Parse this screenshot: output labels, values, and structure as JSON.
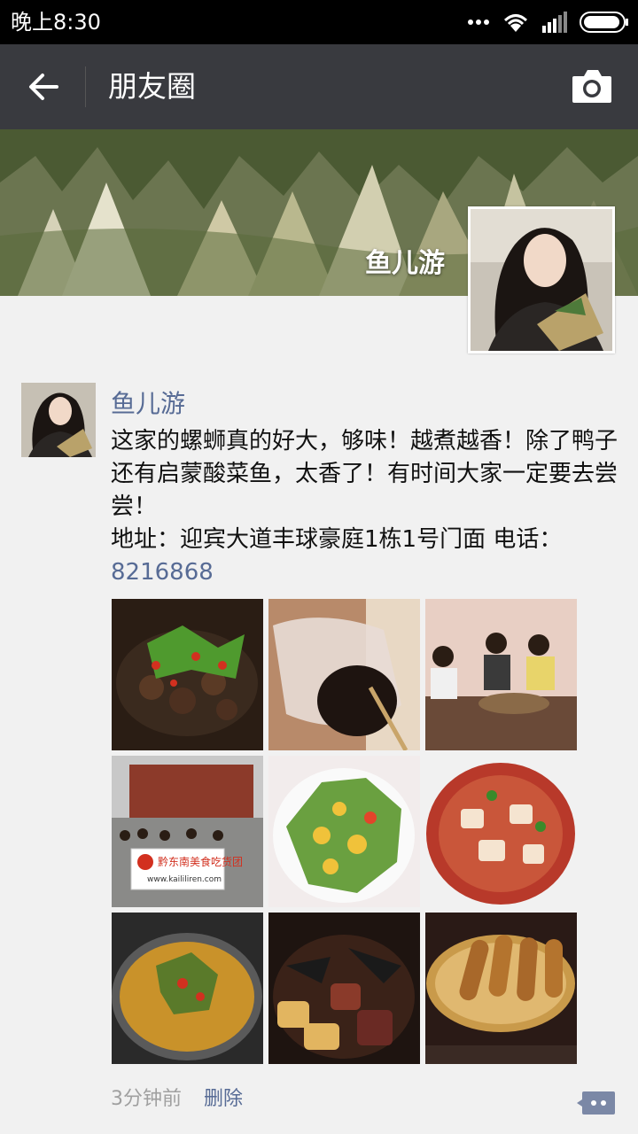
{
  "status_bar": {
    "time": "晚上8:30"
  },
  "header": {
    "title": "朋友圈"
  },
  "profile": {
    "name": "鱼儿游"
  },
  "post": {
    "author": "鱼儿游",
    "text": "这家的螺蛳真的好大，够味！越煮越香！除了鸭子还有启蒙酸菜鱼，太香了！有时间大家一定要去尝尝！",
    "address_line": "地址：迎宾大道丰球豪庭1栋1号门面 电话：",
    "phone": "8216868",
    "banner_text": "黔东南美食吃货团",
    "banner_url": "www.kaililiren.com",
    "time": "3分钟前",
    "delete_label": "删除"
  },
  "colors": {
    "link": "#576b95",
    "app_bar": "#393a3f"
  }
}
